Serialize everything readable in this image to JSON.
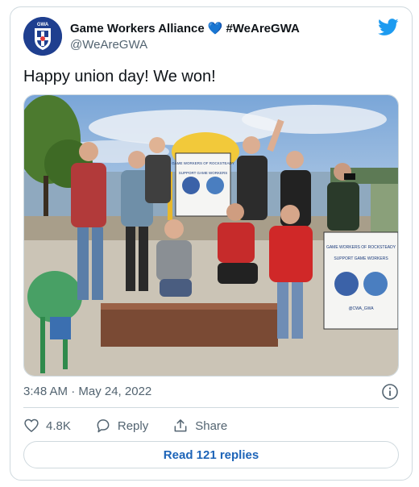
{
  "account": {
    "display_name": "Game Workers Alliance",
    "heart": "💙",
    "hashtag": "#WeAreGWA",
    "handle": "@WeAreGWA",
    "avatar_label": "GWA",
    "avatar_icon": "shield-badge-icon"
  },
  "brand": {
    "icon": "twitter-bird-icon",
    "color": "#1d9bf0"
  },
  "tweet": {
    "text": "Happy union day! We won!",
    "timestamp": "3:48 AM · May 24, 2022"
  },
  "photo": {
    "sign_left": [
      "GAME WORKERS OF ROCKSTEADY",
      "SUPPORT GAME WORKERS"
    ],
    "sign_right": [
      "GAME WORKERS OF ROCKSTEADY",
      "SUPPORT GAME WORKERS",
      "@CWA_GWA"
    ]
  },
  "actions": {
    "like_count": "4.8K",
    "reply_label": "Reply",
    "share_label": "Share"
  },
  "read_replies": "Read 121 replies",
  "colors": {
    "accent": "#1d64b8",
    "muted": "#536471",
    "border": "#cfd9de"
  }
}
